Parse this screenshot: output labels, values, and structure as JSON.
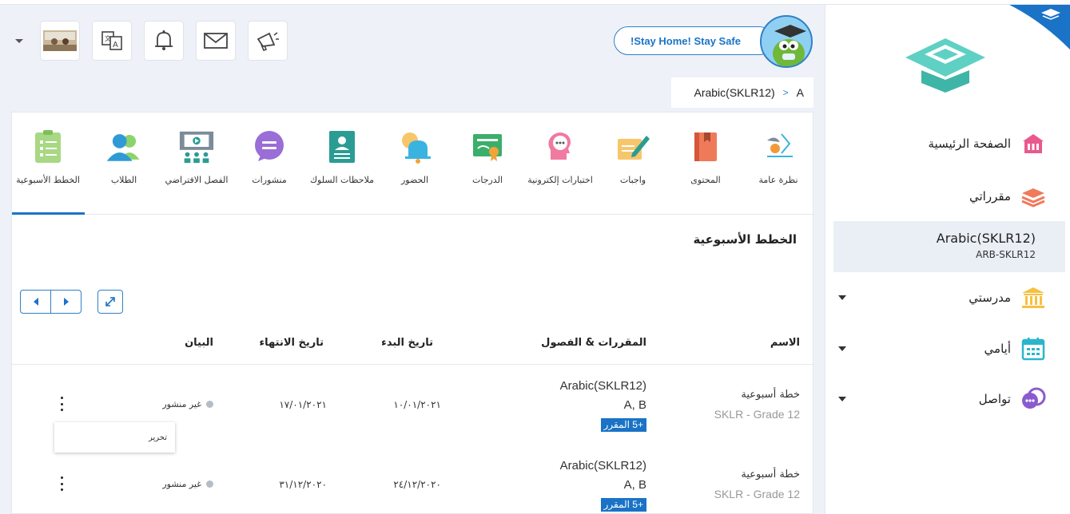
{
  "header": {
    "announcement_button": "!Stay Home! Stay Safe",
    "breadcrumb": {
      "course": "Arabic(SKLR12)",
      "separator": ">",
      "section": "A"
    },
    "toolbar_icons": [
      "megaphone-icon",
      "mail-icon",
      "bell-icon",
      "language-icon",
      "profile-thumbnail"
    ]
  },
  "sidebar": {
    "home": "الصفحة الرئيسية",
    "my_courses": "مقرراتي",
    "active_course": {
      "title": "Arabic(SKLR12)",
      "code": "ARB-SKLR12"
    },
    "my_school": "مدرستي",
    "my_days": "أيامي",
    "communication": "تواصل"
  },
  "tabs": [
    {
      "label": "نظرة عامة",
      "icon": "overview-icon"
    },
    {
      "label": "المحتوى",
      "icon": "book-icon"
    },
    {
      "label": "واجبات",
      "icon": "assignment-icon"
    },
    {
      "label": "اختبارات إلكترونية",
      "icon": "quiz-icon"
    },
    {
      "label": "الدرجات",
      "icon": "grades-icon"
    },
    {
      "label": "الحضور",
      "icon": "attendance-bell-icon"
    },
    {
      "label": "ملاحظات السلوك",
      "icon": "behavior-icon"
    },
    {
      "label": "منشورات",
      "icon": "posts-icon"
    },
    {
      "label": "الفصل الافتراضي",
      "icon": "virtual-class-icon"
    },
    {
      "label": "الطلاب",
      "icon": "students-icon"
    },
    {
      "label": "الخطط الأسبوعية",
      "icon": "weekly-plan-icon"
    }
  ],
  "section_title": "الخطط الأسبوعية",
  "table": {
    "headers": {
      "name": "الاسم",
      "courses": "المقررات & الفصول",
      "start": "تاريخ البدء",
      "end": "تاريخ الانتهاء",
      "status": "البيان"
    },
    "rows": [
      {
        "name": "خطة أسبوعية",
        "grade": "SKLR - Grade 12",
        "course": "Arabic(SKLR12)",
        "sections": "A, B",
        "badge": "+5 المقرر",
        "start": "١٠/٠١/٢٠٢١",
        "end": "١٧/٠١/٢٠٢١",
        "status": "غير منشور"
      },
      {
        "name": "خطة أسبوعية",
        "grade": "SKLR - Grade 12",
        "course": "Arabic(SKLR12)",
        "sections": "A, B",
        "badge": "+5 المقرر",
        "start": "٢٤/١٢/٢٠٢٠",
        "end": "٣١/١٢/٢٠٢٠",
        "status": "غير منشور"
      }
    ],
    "row_menu_edit": "تحرير"
  },
  "colors": {
    "accent": "#1a73c6",
    "active_bg": "#eaeef5"
  }
}
